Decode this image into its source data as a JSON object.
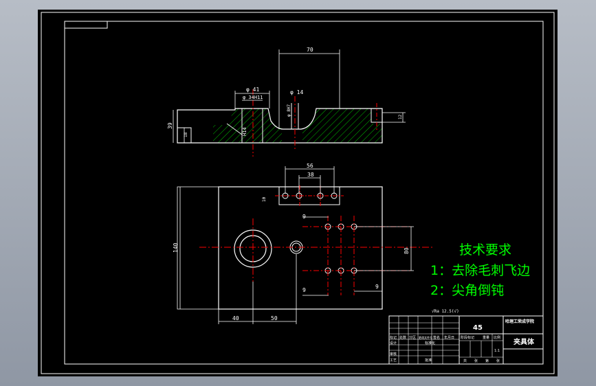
{
  "colors": {
    "viewport_bg": "#b7bdc6",
    "canvas": "#000000",
    "line": "#ffffff",
    "center_line": "#ff0000",
    "hatch": "#00c000",
    "requirements_text": "#00ff00"
  },
  "dimensions": {
    "d70": "70",
    "phi41": "φ 41",
    "phi34h11": "φ 34H11",
    "phi14": "φ 14",
    "phi8h7": "φ 8H7",
    "d39": "39",
    "d18": "18",
    "h14": "H14",
    "d12": "12",
    "d56": "56",
    "d38": "38",
    "d10": "10",
    "d140": "140",
    "d80": "80",
    "d9a": "9",
    "d9b": "9",
    "d9c": "9",
    "d40": "40",
    "d50": "50"
  },
  "surface_note": "√Ra 12.5(√)",
  "requirements": {
    "title": "技术要求",
    "items": [
      "1：去除毛刺飞边",
      "2：尖角倒钝"
    ]
  },
  "title_block": {
    "material": "45",
    "school": "哈理工荣成学院",
    "part_name": "夹具体",
    "scale": "1:1",
    "header_cells": [
      "标记",
      "处数",
      "分区",
      "更改文件号",
      "签名",
      "年月日"
    ],
    "role_rows": [
      "设计",
      "审核",
      "工艺"
    ],
    "mid_cells": [
      "标准化",
      "批准"
    ],
    "stage_headers": [
      "阶段标记",
      "重量",
      "比例"
    ],
    "sheet_cells": [
      "共",
      "张",
      "第",
      "张"
    ]
  }
}
